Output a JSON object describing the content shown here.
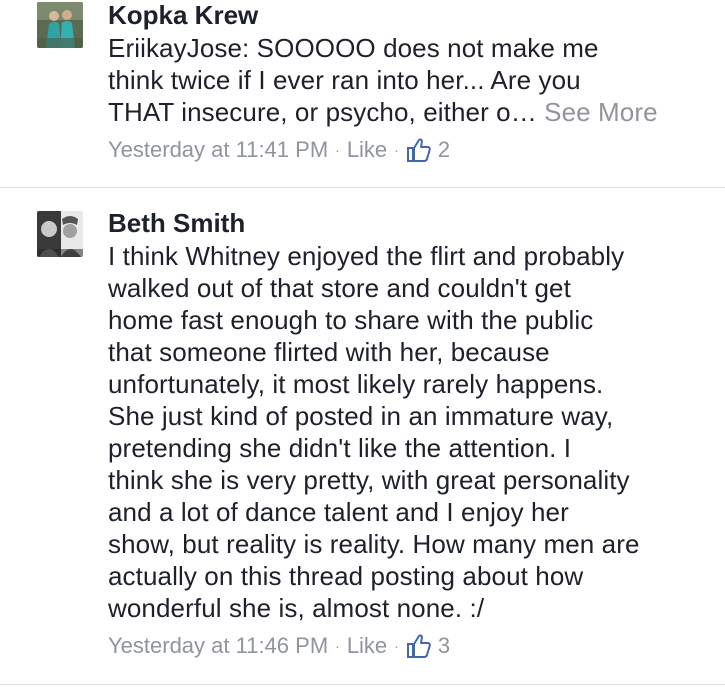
{
  "comments": [
    {
      "author": "Kopka Krew",
      "text": "EriikayJose: SOOOOO does not  make me\nthink twice if I ever ran into her... Are you\nTHAT insecure, or psycho, either o… ",
      "see_more": "See More",
      "timestamp": "Yesterday at 11:41 PM",
      "separator": "·",
      "like_label": "Like",
      "like_count": "2",
      "avatar_icon": "profile-photo-icon"
    },
    {
      "author": "Beth Smith",
      "text": "I think Whitney enjoyed the flirt and probably\nwalked out of that store and couldn't get\nhome fast enough to share with the public\nthat someone flirted with her, because\nunfortunately, it most likely rarely happens.\nShe just kind of posted in an immature way,\npretending she didn't like the attention.  I\nthink she is very pretty, with great personality\nand a lot of dance talent  and I enjoy her\nshow, but reality is reality.  How many men are\nactually on this thread posting about how\nwonderful she is, almost none.  :/",
      "timestamp": "Yesterday at 11:46 PM",
      "separator": "·",
      "like_label": "Like",
      "like_count": "3",
      "avatar_icon": "profile-photo-icon"
    }
  ],
  "colors": {
    "text": "#1d2129",
    "meta": "#90949c",
    "thumb": "#4267b2",
    "divider": "#dddfe2"
  }
}
